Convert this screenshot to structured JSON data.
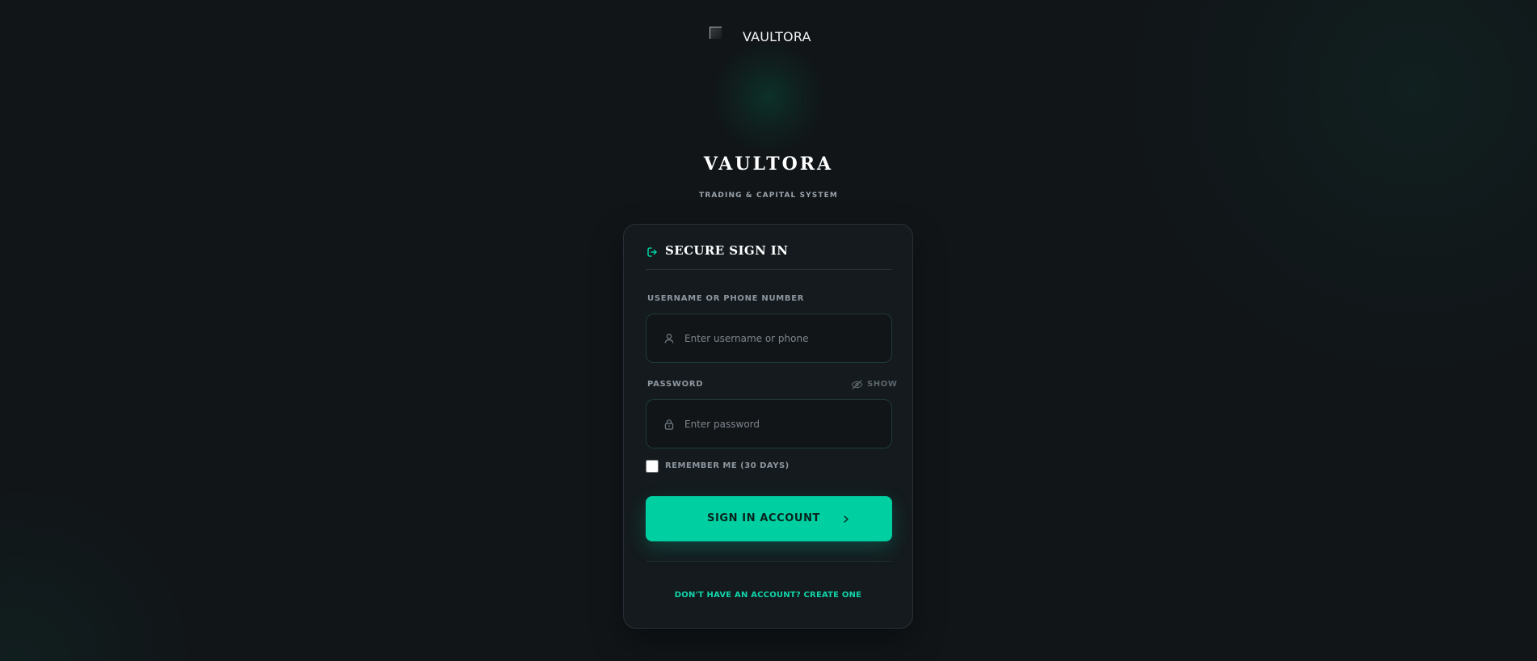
{
  "logo": {
    "alt_text": "VAULTORA",
    "icon": "broken-image-icon"
  },
  "brand": {
    "title": "VAULTORA",
    "subtitle": "TRADING & CAPITAL SYSTEM"
  },
  "signin": {
    "title": "SECURE SIGN IN",
    "header_icon": "sign-in-icon",
    "username": {
      "label": "USERNAME OR PHONE NUMBER",
      "placeholder": "Enter username or phone",
      "value": "",
      "icon": "user-icon"
    },
    "password": {
      "label": "PASSWORD",
      "toggle_label": "SHOW",
      "toggle_icon": "eye-off-icon",
      "placeholder": "Enter password",
      "value": "",
      "icon": "lock-icon"
    },
    "remember": {
      "label": "REMEMBER ME (30 DAYS)",
      "checked": false
    },
    "button": {
      "label": "SIGN IN ACCOUNT",
      "icon": "chevron-right-icon"
    },
    "create_account": {
      "label": "DON'T HAVE AN ACCOUNT? CREATE ONE"
    }
  },
  "colors": {
    "background": "#111518",
    "card": "#141a1e",
    "accent": "#00cfa2",
    "accent_text": "#11d5a9",
    "muted_text": "#8e979f"
  }
}
